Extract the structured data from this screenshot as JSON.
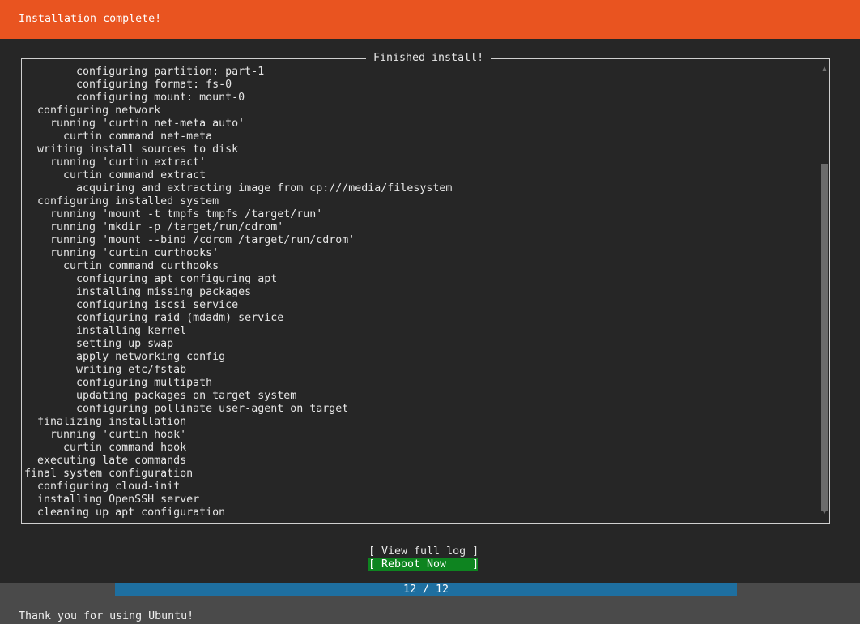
{
  "header": {
    "title": "Installation complete!"
  },
  "log_panel": {
    "title": "Finished install!",
    "lines": [
      "        configuring partition: part-1",
      "        configuring format: fs-0",
      "        configuring mount: mount-0",
      "  configuring network",
      "    running 'curtin net-meta auto'",
      "      curtin command net-meta",
      "  writing install sources to disk",
      "    running 'curtin extract'",
      "      curtin command extract",
      "        acquiring and extracting image from cp:///media/filesystem",
      "  configuring installed system",
      "    running 'mount -t tmpfs tmpfs /target/run'",
      "    running 'mkdir -p /target/run/cdrom'",
      "    running 'mount --bind /cdrom /target/run/cdrom'",
      "    running 'curtin curthooks'",
      "      curtin command curthooks",
      "        configuring apt configuring apt",
      "        installing missing packages",
      "        configuring iscsi service",
      "        configuring raid (mdadm) service",
      "        installing kernel",
      "        setting up swap",
      "        apply networking config",
      "        writing etc/fstab",
      "        configuring multipath",
      "        updating packages on target system",
      "        configuring pollinate user-agent on target",
      "  finalizing installation",
      "    running 'curtin hook'",
      "      curtin command hook",
      "  executing late commands",
      "final system configuration",
      "  configuring cloud-init",
      "  installing OpenSSH server",
      "  cleaning up apt configuration"
    ],
    "scroll": {
      "up_icon": "triangle-up",
      "down_icon": "triangle-down",
      "position_fraction": 0.205,
      "visible_fraction": 0.795
    }
  },
  "buttons": {
    "view_log_label": "[ View full log ]",
    "reboot_label": "[ Reboot Now    ]"
  },
  "progress": {
    "current": 12,
    "total": 12,
    "label": "12 / 12"
  },
  "footer": {
    "message": "Thank you for using Ubuntu!"
  },
  "colors": {
    "header_bg": "#e95420",
    "background": "#262626",
    "button_focus_bg": "#0e8420",
    "progress_fill": "#1e6fa0",
    "footer_bg": "#4a4a4a"
  }
}
